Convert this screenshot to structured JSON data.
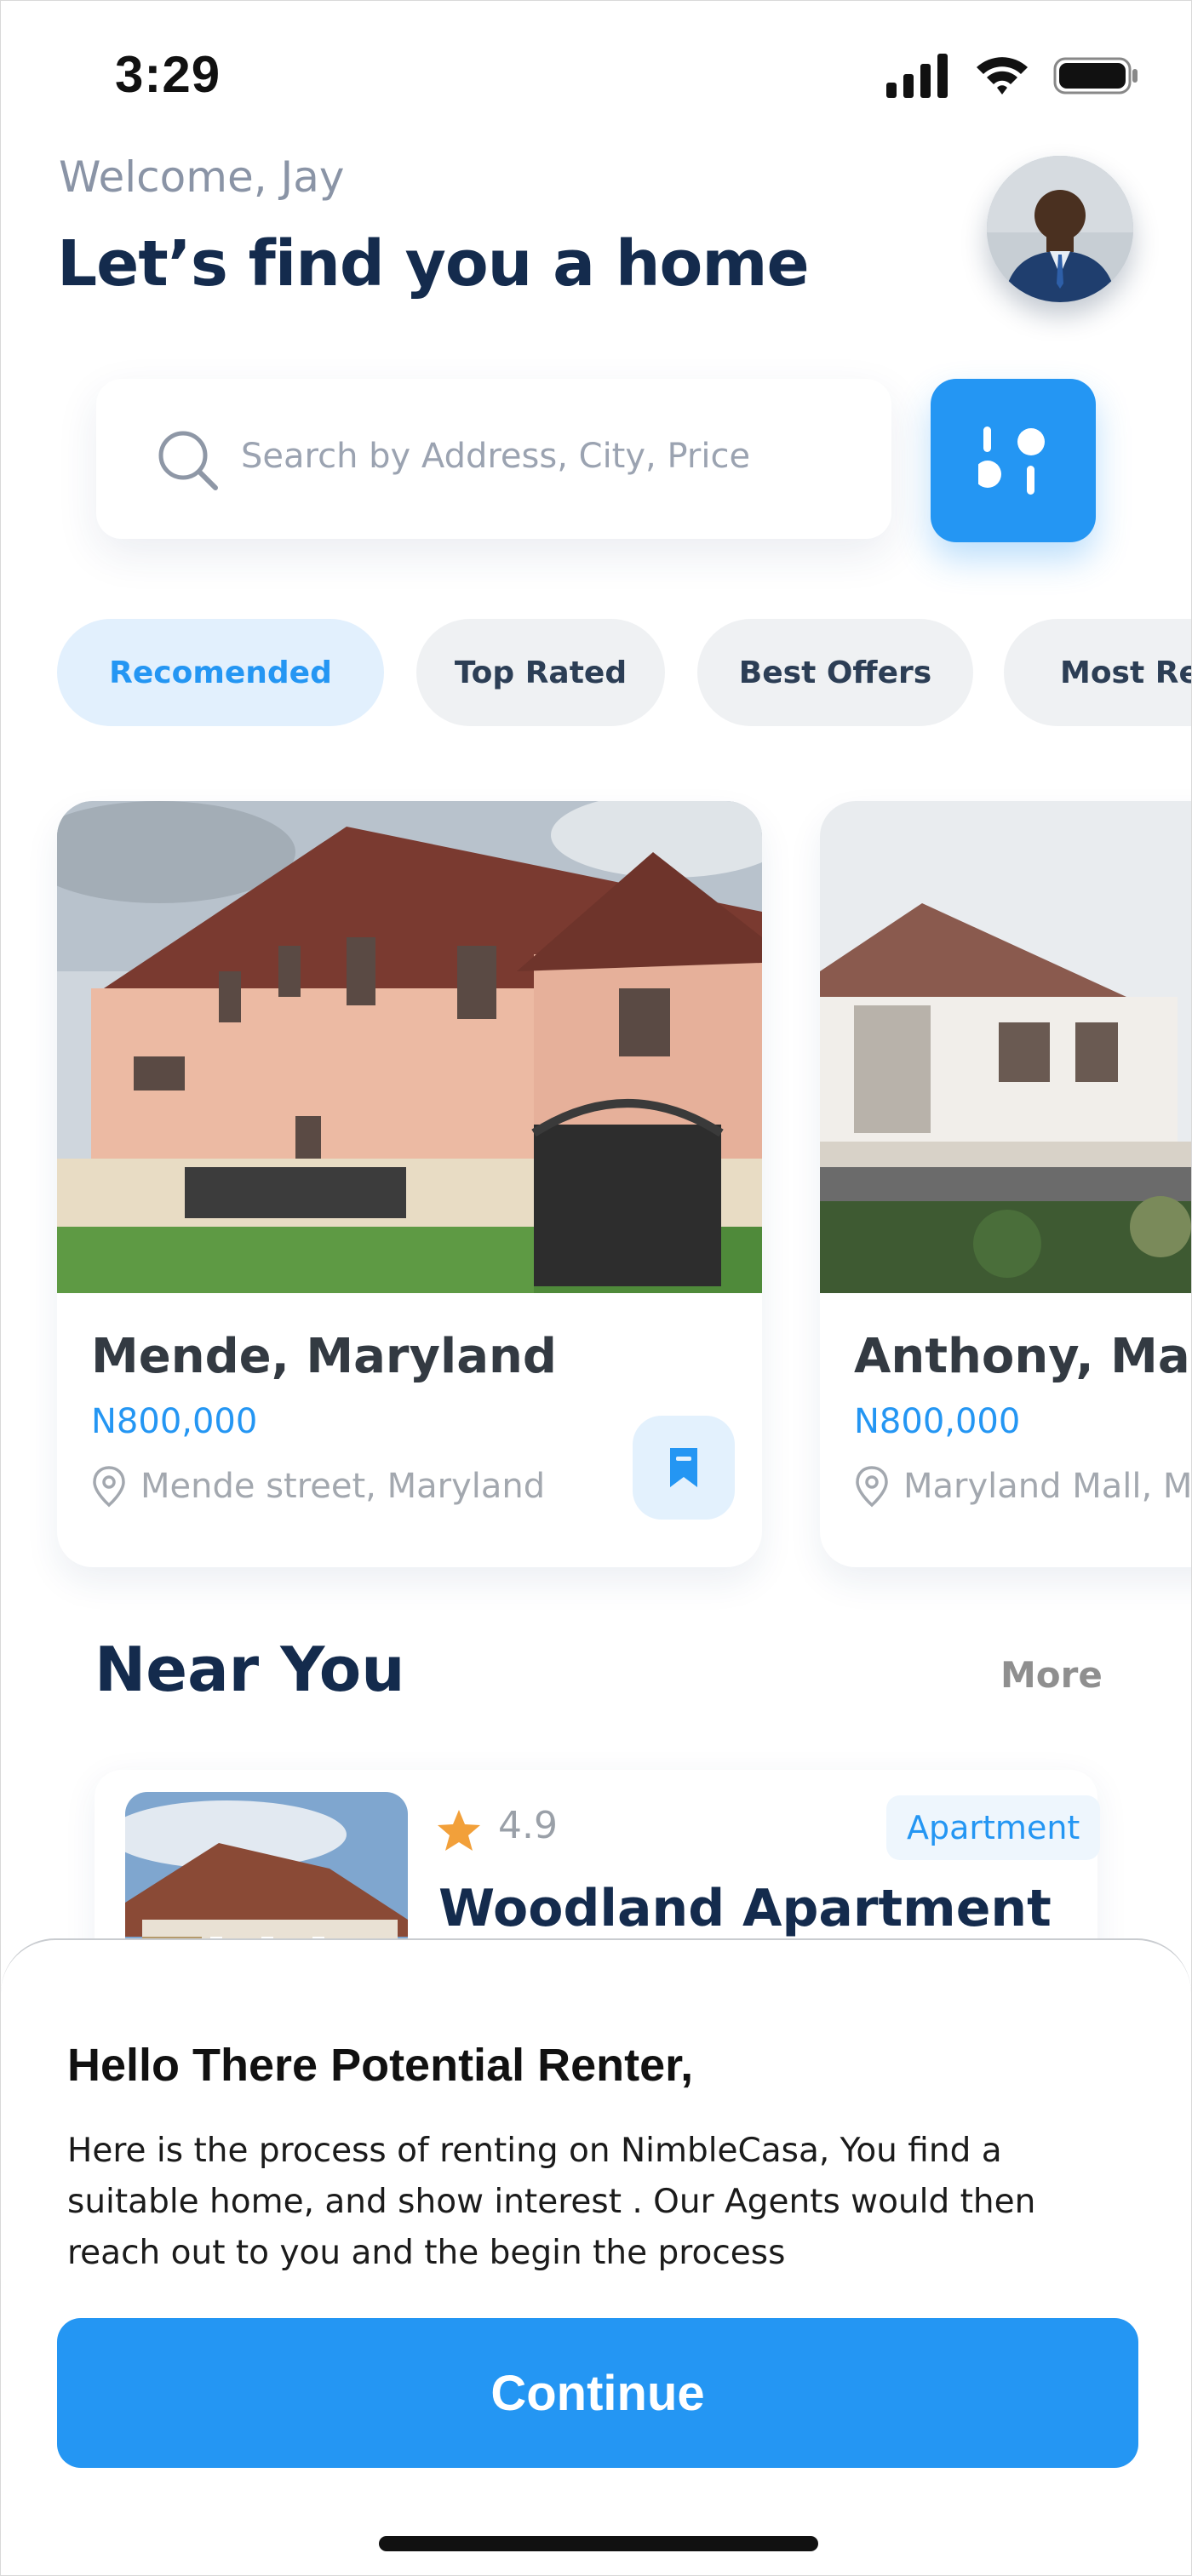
{
  "status_bar": {
    "time": "3:29",
    "icons": [
      "signal-icon",
      "wifi-icon",
      "battery-icon"
    ]
  },
  "header": {
    "welcome": "Welcome, Jay",
    "headline": "Let’s find you a home",
    "avatar_icon": "user-avatar"
  },
  "search": {
    "placeholder": "Search by Address, City, Price",
    "icon": "search-icon",
    "filter_icon": "filter-icon"
  },
  "tabs": [
    {
      "label": "Recomended",
      "active": true
    },
    {
      "label": "Top Rated",
      "active": false
    },
    {
      "label": "Best Offers",
      "active": false
    },
    {
      "label": "Most Re",
      "active": false
    }
  ],
  "properties": [
    {
      "title": "Mende, Maryland",
      "price": "N800,000",
      "location": "Mende street, Maryland",
      "icon": "bookmark-icon"
    },
    {
      "title": "Anthony, Mary",
      "price": "N800,000",
      "location": "Maryland Mall, M",
      "icon": "bookmark-icon"
    }
  ],
  "near_you": {
    "title": "Near You",
    "more": "More",
    "items": [
      {
        "rating": "4.9",
        "type": "Apartment",
        "title": "Woodland Apartment"
      }
    ]
  },
  "sheet": {
    "title": "Hello There Potential Renter,",
    "body": "Here is the process of renting on NimbleCasa, You find a suitable home, and show interest . Our Agents would then reach out to you and the begin the process",
    "continue_label": "Continue"
  },
  "colors": {
    "accent": "#2496f3",
    "navy": "#142b4d",
    "star": "#f2a03a"
  }
}
